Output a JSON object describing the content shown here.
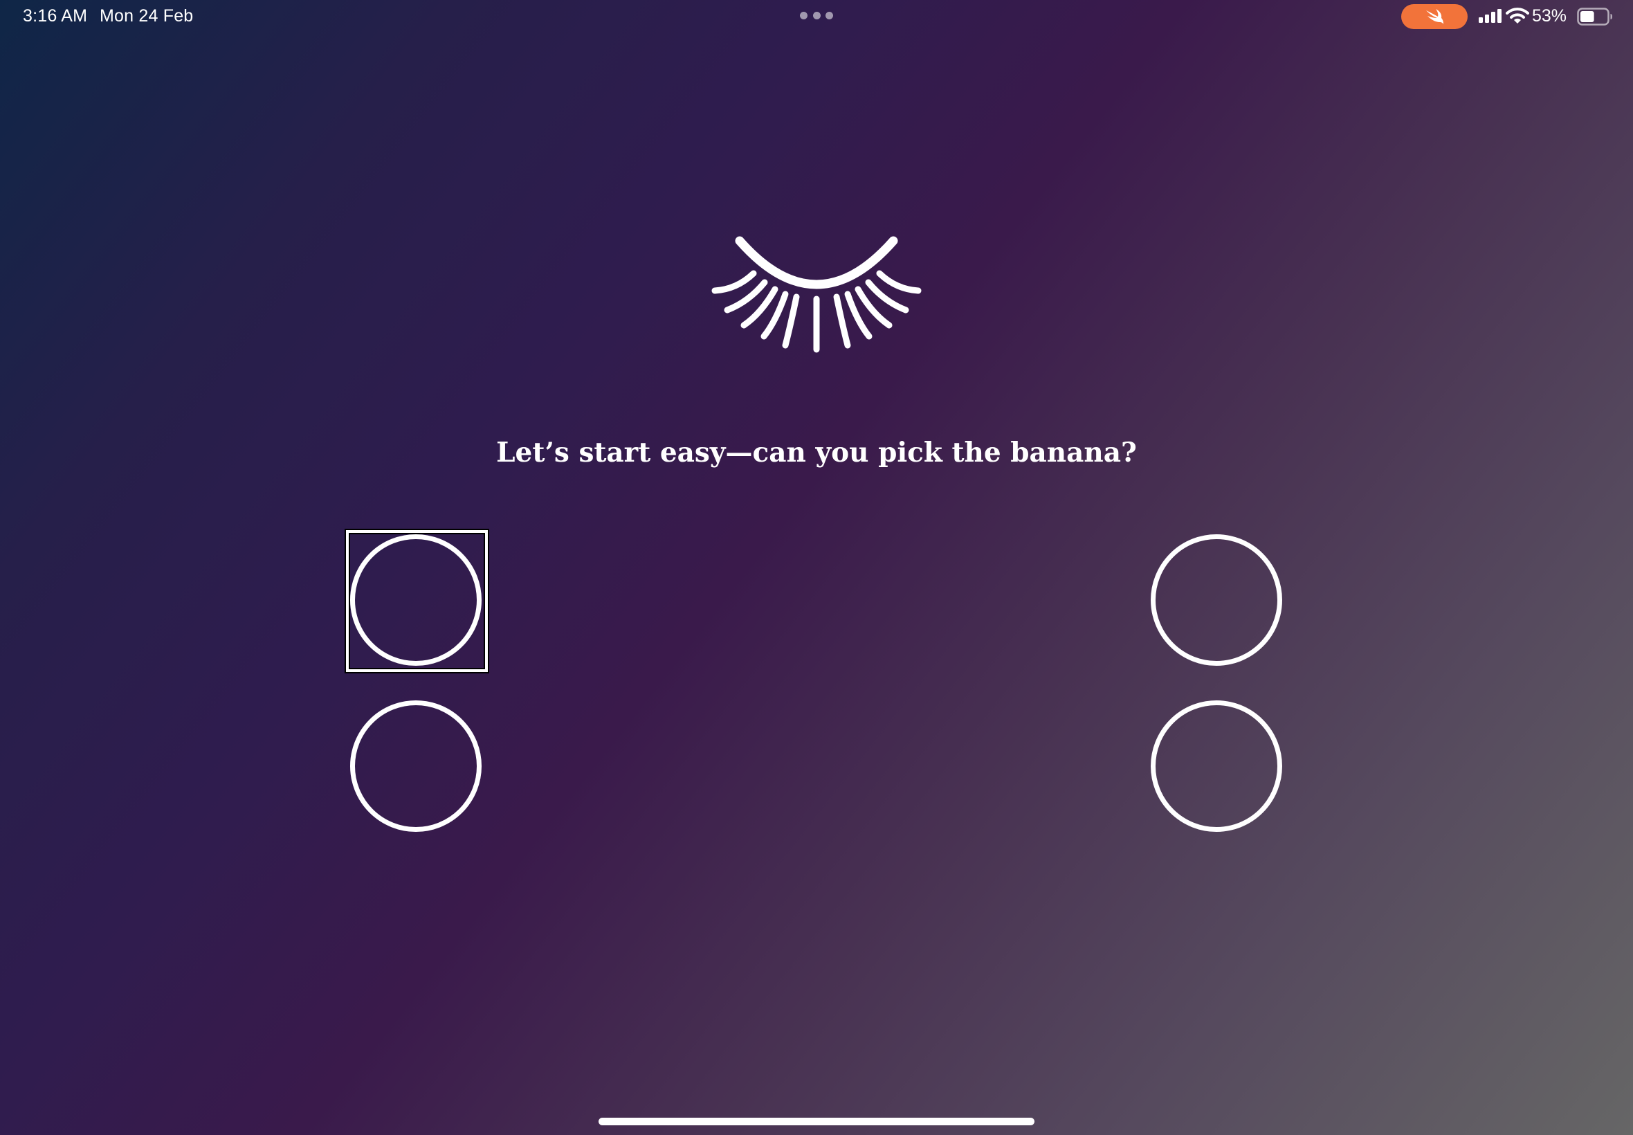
{
  "status_bar": {
    "time": "3:16 AM",
    "date": "Mon 24 Feb",
    "battery_percent": "53%",
    "battery_level": 0.53,
    "signal_bars": 4,
    "active_app_indicator_icon": "swift-icon",
    "colors": {
      "app_indicator": "#f2733a"
    }
  },
  "header": {
    "logo_icon": "closed-eye-lashes-icon"
  },
  "question": {
    "prompt": "Let’s start easy—can you pick the banana?"
  },
  "choices": [
    {
      "id": "choice-1",
      "focused": true
    },
    {
      "id": "choice-2",
      "focused": false
    },
    {
      "id": "choice-3",
      "focused": false
    },
    {
      "id": "choice-4",
      "focused": false
    }
  ],
  "theme": {
    "gradient_colors": [
      "#0f2647",
      "#2f1c4e",
      "#3a1a4b",
      "#564a5e",
      "#666666"
    ],
    "foreground": "#ffffff"
  }
}
